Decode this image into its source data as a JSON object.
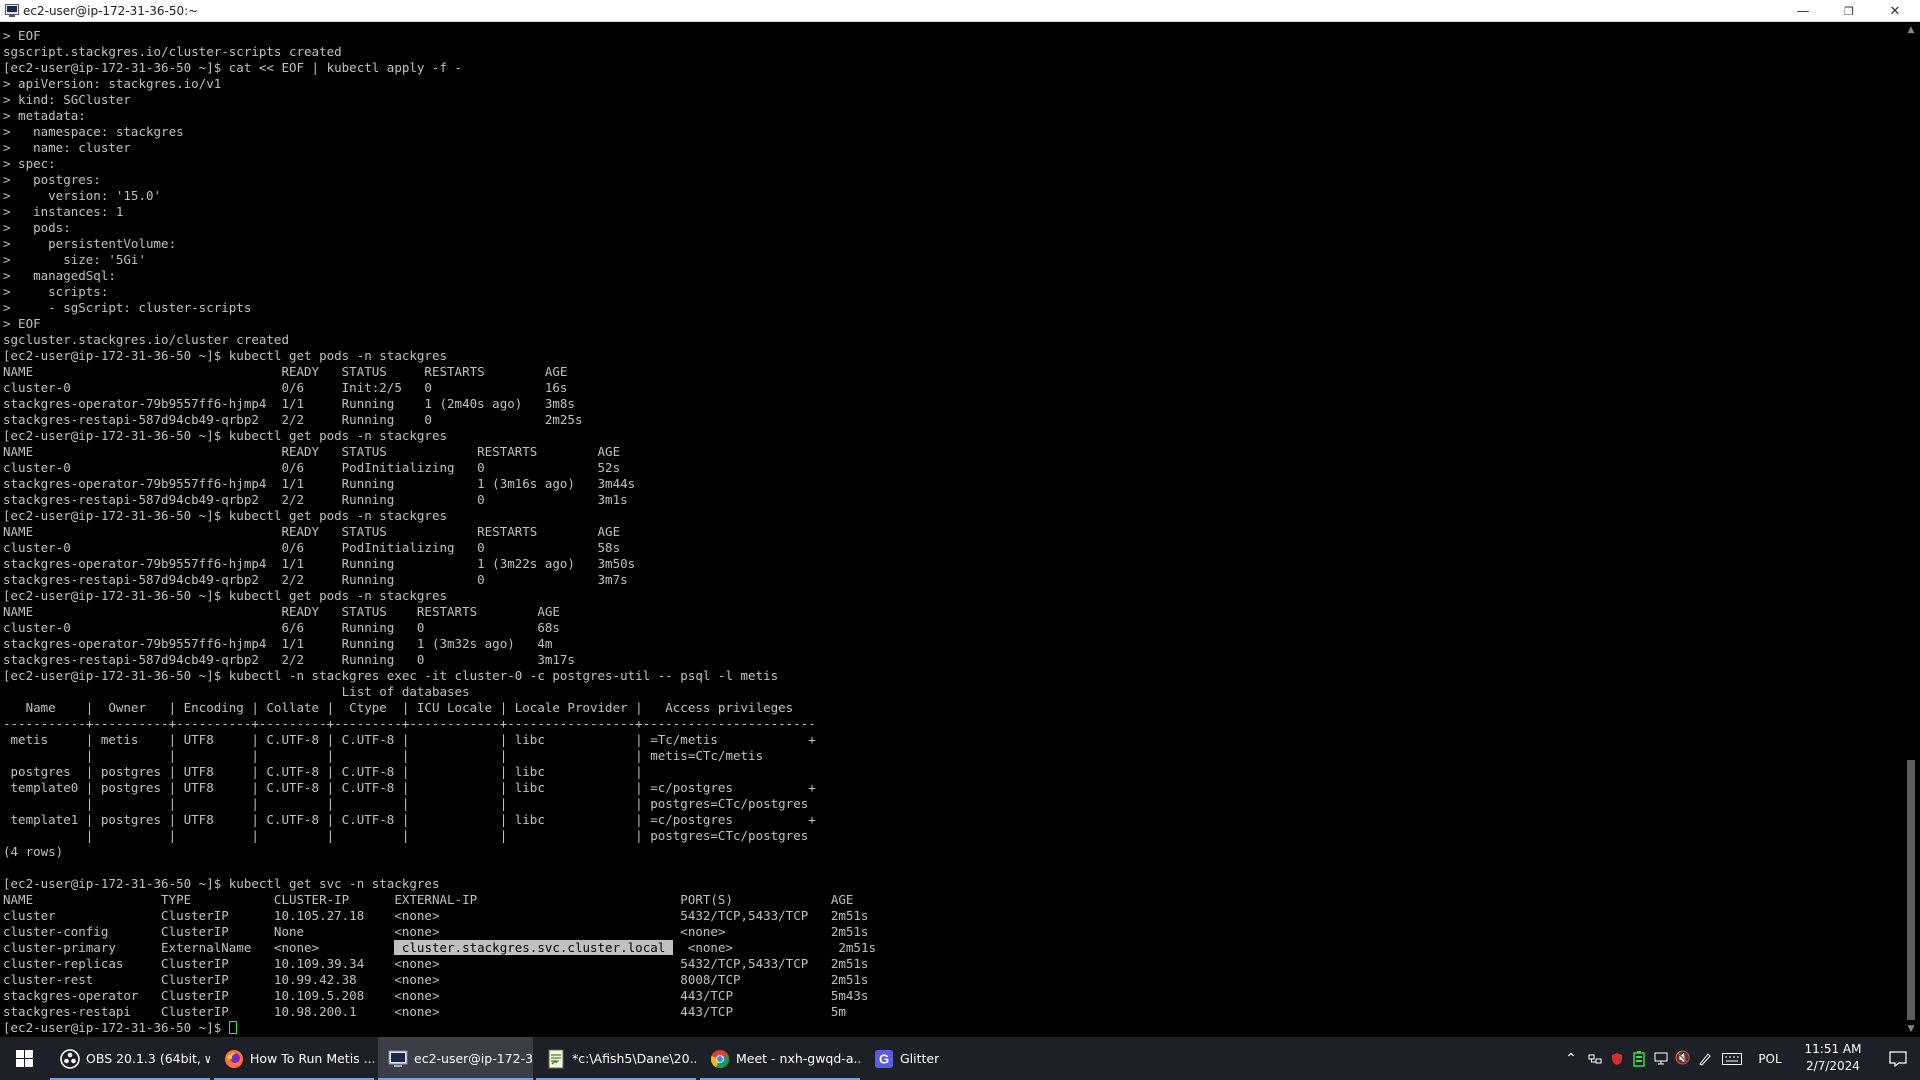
{
  "window": {
    "title": "ec2-user@ip-172-31-36-50:~",
    "minimize_glyph": "—",
    "restore_glyph": "❐",
    "close_glyph": "✕"
  },
  "terminal": {
    "prompt_text": "[ec2-user@ip-172-31-36-50 ~]$ ",
    "lines": [
      [
        {
          "t": "> EOF"
        }
      ],
      [
        {
          "t": "sgscript.stackgres.io/cluster-scripts created"
        }
      ],
      [
        {
          "t": "[ec2-user@ip-172-31-36-50 ~]$ cat << EOF | kubectl apply -f -"
        }
      ],
      [
        {
          "t": "> apiVersion: stackgres.io/v1"
        }
      ],
      [
        {
          "t": "> kind: SGCluster"
        }
      ],
      [
        {
          "t": "> metadata:"
        }
      ],
      [
        {
          "t": ">   namespace: stackgres"
        }
      ],
      [
        {
          "t": ">   name: cluster"
        }
      ],
      [
        {
          "t": "> spec:"
        }
      ],
      [
        {
          "t": ">   postgres:"
        }
      ],
      [
        {
          "t": ">     version: '15.0'"
        }
      ],
      [
        {
          "t": ">   instances: 1"
        }
      ],
      [
        {
          "t": ">   pods:"
        }
      ],
      [
        {
          "t": ">     persistentVolume:"
        }
      ],
      [
        {
          "t": ">       size: '5Gi'"
        }
      ],
      [
        {
          "t": ">   managedSql:"
        }
      ],
      [
        {
          "t": ">     scripts:"
        }
      ],
      [
        {
          "t": ">     - sgScript: cluster-scripts"
        }
      ],
      [
        {
          "t": "> EOF"
        }
      ],
      [
        {
          "t": "sgcluster.stackgres.io/cluster created"
        }
      ],
      [
        {
          "t": "[ec2-user@ip-172-31-36-50 ~]$ kubectl get pods -n stackgres"
        }
      ],
      [
        {
          "t": "NAME                                 READY   STATUS     RESTARTS        AGE"
        }
      ],
      [
        {
          "t": "cluster-0                            0/6     Init:2/5   0               16s"
        }
      ],
      [
        {
          "t": "stackgres-operator-79b9557ff6-hjmp4  1/1     Running    1 (2m40s ago)   3m8s"
        }
      ],
      [
        {
          "t": "stackgres-restapi-587d94cb49-qrbp2   2/2     Running    0               2m25s"
        }
      ],
      [
        {
          "t": "[ec2-user@ip-172-31-36-50 ~]$ kubectl get pods -n stackgres"
        }
      ],
      [
        {
          "t": "NAME                                 READY   STATUS            RESTARTS        AGE"
        }
      ],
      [
        {
          "t": "cluster-0                            0/6     PodInitializing   0               52s"
        }
      ],
      [
        {
          "t": "stackgres-operator-79b9557ff6-hjmp4  1/1     Running           1 (3m16s ago)   3m44s"
        }
      ],
      [
        {
          "t": "stackgres-restapi-587d94cb49-qrbp2   2/2     Running           0               3m1s"
        }
      ],
      [
        {
          "t": "[ec2-user@ip-172-31-36-50 ~]$ kubectl get pods -n stackgres"
        }
      ],
      [
        {
          "t": "NAME                                 READY   STATUS            RESTARTS        AGE"
        }
      ],
      [
        {
          "t": "cluster-0                            0/6     PodInitializing   0               58s"
        }
      ],
      [
        {
          "t": "stackgres-operator-79b9557ff6-hjmp4  1/1     Running           1 (3m22s ago)   3m50s"
        }
      ],
      [
        {
          "t": "stackgres-restapi-587d94cb49-qrbp2   2/2     Running           0               3m7s"
        }
      ],
      [
        {
          "t": "[ec2-user@ip-172-31-36-50 ~]$ kubectl get pods -n stackgres"
        }
      ],
      [
        {
          "t": "NAME                                 READY   STATUS    RESTARTS        AGE"
        }
      ],
      [
        {
          "t": "cluster-0                            6/6     Running   0               68s"
        }
      ],
      [
        {
          "t": "stackgres-operator-79b9557ff6-hjmp4  1/1     Running   1 (3m32s ago)   4m"
        }
      ],
      [
        {
          "t": "stackgres-restapi-587d94cb49-qrbp2   2/2     Running   0               3m17s"
        }
      ],
      [
        {
          "t": "[ec2-user@ip-172-31-36-50 ~]$ kubectl -n stackgres exec -it cluster-0 -c postgres-util -- psql -l metis"
        }
      ],
      [
        {
          "t": "                                             List of databases"
        }
      ],
      [
        {
          "t": "   Name    |  Owner   | Encoding | Collate |  Ctype  | ICU Locale | Locale Provider |   Access privileges"
        }
      ],
      [
        {
          "t": "-----------+----------+----------+---------+---------+------------+-----------------+-----------------------"
        }
      ],
      [
        {
          "t": " metis     | metis    | UTF8     | C.UTF-8 | C.UTF-8 |            | libc            | =Tc/metis            +"
        }
      ],
      [
        {
          "t": "           |          |          |         |         |            |                 | metis=CTc/metis"
        }
      ],
      [
        {
          "t": " postgres  | postgres | UTF8     | C.UTF-8 | C.UTF-8 |            | libc            |"
        }
      ],
      [
        {
          "t": " template0 | postgres | UTF8     | C.UTF-8 | C.UTF-8 |            | libc            | =c/postgres          +"
        }
      ],
      [
        {
          "t": "           |          |          |         |         |            |                 | postgres=CTc/postgres"
        }
      ],
      [
        {
          "t": " template1 | postgres | UTF8     | C.UTF-8 | C.UTF-8 |            | libc            | =c/postgres          +"
        }
      ],
      [
        {
          "t": "           |          |          |         |         |            |                 | postgres=CTc/postgres"
        }
      ],
      [
        {
          "t": "(4 rows)"
        }
      ],
      [
        {
          "t": ""
        }
      ],
      [
        {
          "t": "[ec2-user@ip-172-31-36-50 ~]$ kubectl get svc -n stackgres"
        }
      ],
      [
        {
          "t": "NAME                 TYPE           CLUSTER-IP      EXTERNAL-IP                           PORT(S)             AGE"
        }
      ],
      [
        {
          "t": "cluster              ClusterIP      10.105.27.18    <none>                                5432/TCP,5433/TCP   2m51s"
        }
      ],
      [
        {
          "t": "cluster-config       ClusterIP      None            <none>                                <none>              2m51s"
        }
      ],
      [
        {
          "t": "cluster-primary      ExternalName   <none>          "
        },
        {
          "t": " cluster.stackgres.svc.cluster.local ",
          "sel": true
        },
        {
          "t": "  <none>              2m51s"
        }
      ],
      [
        {
          "t": "cluster-replicas     ClusterIP      10.109.39.34    <none>                                5432/TCP,5433/TCP   2m51s"
        }
      ],
      [
        {
          "t": "cluster-rest         ClusterIP      10.99.42.38     <none>                                8008/TCP            2m51s"
        }
      ],
      [
        {
          "t": "stackgres-operator   ClusterIP      10.109.5.208    <none>                                443/TCP             5m43s"
        }
      ],
      [
        {
          "t": "stackgres-restapi    ClusterIP      10.98.200.1     <none>                                443/TCP             5m"
        }
      ]
    ]
  },
  "taskbar": {
    "items": [
      {
        "label": "OBS 20.1.3 (64bit, w...",
        "icon": "obs-icon",
        "color": "#ffffff"
      },
      {
        "label": "How To Run Metis ...",
        "icon": "firefox-icon",
        "color": "#ff7139"
      },
      {
        "label": "ec2-user@ip-172-3...",
        "icon": "terminal-icon",
        "color": "#b0c4de"
      },
      {
        "label": "*c:\\Afish5\\Dane\\20...",
        "icon": "notepad-icon",
        "color": "#8bc34a"
      },
      {
        "label": "Meet - nxh-gwqd-a...",
        "icon": "chrome-icon",
        "color": "#4285f4"
      },
      {
        "label": "Glitter",
        "icon": "glitter-icon",
        "color": "#5c5ce0"
      }
    ],
    "tray": {
      "language": "POL",
      "time": "11:51 AM",
      "date": "2/7/2024",
      "chevron_glyph": "⌃",
      "volume_glyph": "🔇"
    }
  }
}
